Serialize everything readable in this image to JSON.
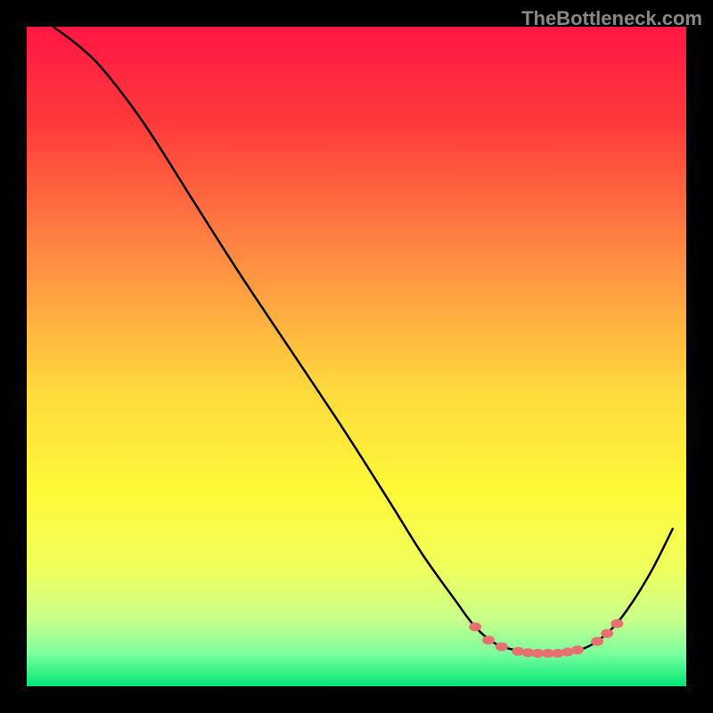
{
  "watermark": "TheBottleneck.com",
  "chart_data": {
    "type": "line",
    "title": "",
    "xlabel": "",
    "ylabel": "",
    "xlim": [
      0,
      100
    ],
    "ylim": [
      0,
      100
    ],
    "gradient_stops": [
      {
        "offset": 0,
        "color": "#ff1744"
      },
      {
        "offset": 15,
        "color": "#ff3b3b"
      },
      {
        "offset": 35,
        "color": "#ff8c42"
      },
      {
        "offset": 55,
        "color": "#ffd93d"
      },
      {
        "offset": 70,
        "color": "#fff838"
      },
      {
        "offset": 82,
        "color": "#f0ff5c"
      },
      {
        "offset": 90,
        "color": "#c8ff8c"
      },
      {
        "offset": 95,
        "color": "#7dff9e"
      },
      {
        "offset": 100,
        "color": "#00e676"
      }
    ],
    "series": [
      {
        "name": "curve",
        "type": "line",
        "color": "#000000",
        "points": [
          {
            "x": 4,
            "y": 100
          },
          {
            "x": 8,
            "y": 97
          },
          {
            "x": 12,
            "y": 93
          },
          {
            "x": 18,
            "y": 85
          },
          {
            "x": 25,
            "y": 74
          },
          {
            "x": 32,
            "y": 63
          },
          {
            "x": 40,
            "y": 51
          },
          {
            "x": 48,
            "y": 39
          },
          {
            "x": 55,
            "y": 28
          },
          {
            "x": 60,
            "y": 20
          },
          {
            "x": 65,
            "y": 13
          },
          {
            "x": 68,
            "y": 9
          },
          {
            "x": 71,
            "y": 6.5
          },
          {
            "x": 74,
            "y": 5.5
          },
          {
            "x": 77,
            "y": 5
          },
          {
            "x": 80,
            "y": 5
          },
          {
            "x": 83,
            "y": 5.3
          },
          {
            "x": 86,
            "y": 6.5
          },
          {
            "x": 89,
            "y": 9
          },
          {
            "x": 92,
            "y": 13
          },
          {
            "x": 95,
            "y": 18
          },
          {
            "x": 98,
            "y": 24
          }
        ]
      },
      {
        "name": "markers",
        "type": "scatter",
        "color": "#e87070",
        "points": [
          {
            "x": 68,
            "y": 9
          },
          {
            "x": 70,
            "y": 7
          },
          {
            "x": 72,
            "y": 6
          },
          {
            "x": 74.5,
            "y": 5.3
          },
          {
            "x": 76,
            "y": 5.1
          },
          {
            "x": 77.5,
            "y": 5
          },
          {
            "x": 79,
            "y": 5
          },
          {
            "x": 80.5,
            "y": 5
          },
          {
            "x": 82,
            "y": 5.2
          },
          {
            "x": 83.5,
            "y": 5.5
          },
          {
            "x": 86.5,
            "y": 6.8
          },
          {
            "x": 88,
            "y": 8
          },
          {
            "x": 89.5,
            "y": 9.5
          }
        ]
      }
    ]
  }
}
